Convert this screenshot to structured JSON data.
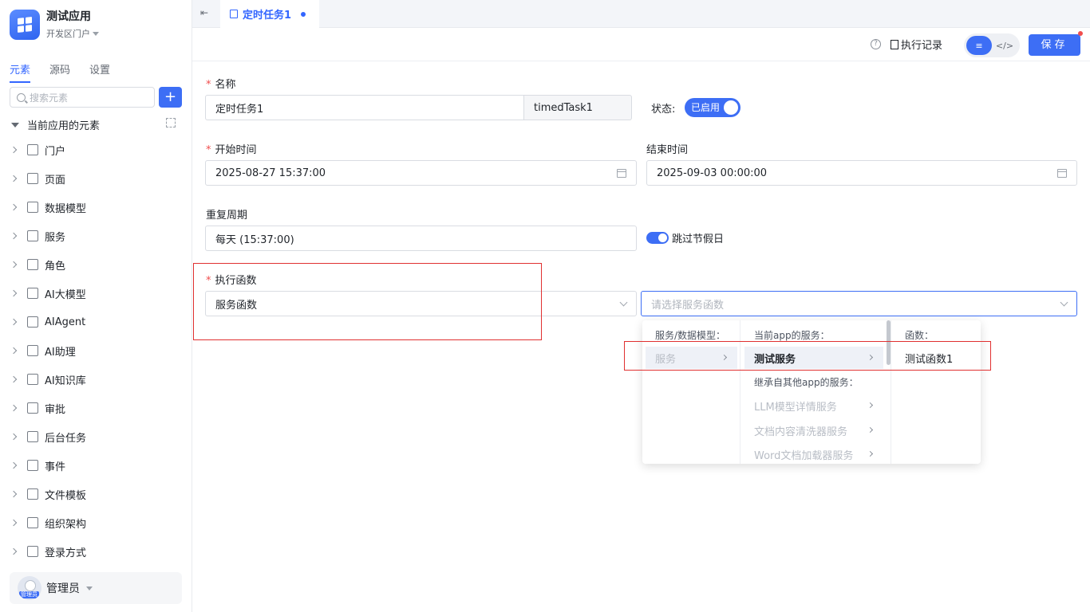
{
  "app": {
    "name": "测试应用",
    "portal": "开发区门户"
  },
  "sidebar": {
    "tabs": [
      "元素",
      "源码",
      "设置"
    ],
    "search_placeholder": "搜索元素",
    "add_label": "+",
    "section_title": "当前应用的元素",
    "items": [
      {
        "label": "门户",
        "icon": "home-icon"
      },
      {
        "label": "页面",
        "icon": "page-icon"
      },
      {
        "label": "数据模型",
        "icon": "table-icon"
      },
      {
        "label": "服务",
        "icon": "database-icon"
      },
      {
        "label": "角色",
        "icon": "role-icon"
      },
      {
        "label": "AI大模型",
        "icon": "cube-icon"
      },
      {
        "label": "AIAgent",
        "icon": "robot-icon"
      },
      {
        "label": "AI助理",
        "icon": "ai-icon"
      },
      {
        "label": "AI知识库",
        "icon": "book-icon"
      },
      {
        "label": "审批",
        "icon": "stamp-icon"
      },
      {
        "label": "后台任务",
        "icon": "clipboard-icon"
      },
      {
        "label": "事件",
        "icon": "event-icon"
      },
      {
        "label": "文件模板",
        "icon": "file-icon"
      },
      {
        "label": "组织架构",
        "icon": "org-icon"
      },
      {
        "label": "登录方式",
        "icon": "login-icon"
      }
    ],
    "user": {
      "name": "管理员",
      "avatar_tag": "管理员"
    }
  },
  "tabbar": {
    "active_tab": "定时任务1"
  },
  "toolbar": {
    "help": "?",
    "record_label": "执行记录",
    "save_label": "保存",
    "mode_visual": "≡",
    "mode_code": "</>"
  },
  "form": {
    "name_label": "名称",
    "name_value": "定时任务1",
    "name_code": "timedTask1",
    "status_label": "状态:",
    "status_value": "已启用",
    "start_label": "开始时间",
    "start_value": "2025-08-27 15:37:00",
    "end_label": "结束时间",
    "end_value": "2025-09-03 00:00:00",
    "repeat_label": "重复周期",
    "repeat_value": "每天 (15:37:00)",
    "skip_holiday_label": "跳过节假日",
    "func_label": "执行函数",
    "func_type_value": "服务函数",
    "func_service_placeholder": "请选择服务函数"
  },
  "cascader": {
    "col1_header": "服务/数据模型：",
    "col1_option": "服务",
    "col2_header": "当前app的服务：",
    "col2_selected": "测试服务",
    "col2_inherit_header": "继承自其他app的服务：",
    "col2_inherited": [
      "LLM模型详情服务",
      "文档内容清洗器服务",
      "Word文档加载器服务"
    ],
    "col3_header": "函数：",
    "col3_option": "测试函数1"
  },
  "colors": {
    "accent": "#3d6ef5",
    "highlight_box": "#e03030"
  }
}
